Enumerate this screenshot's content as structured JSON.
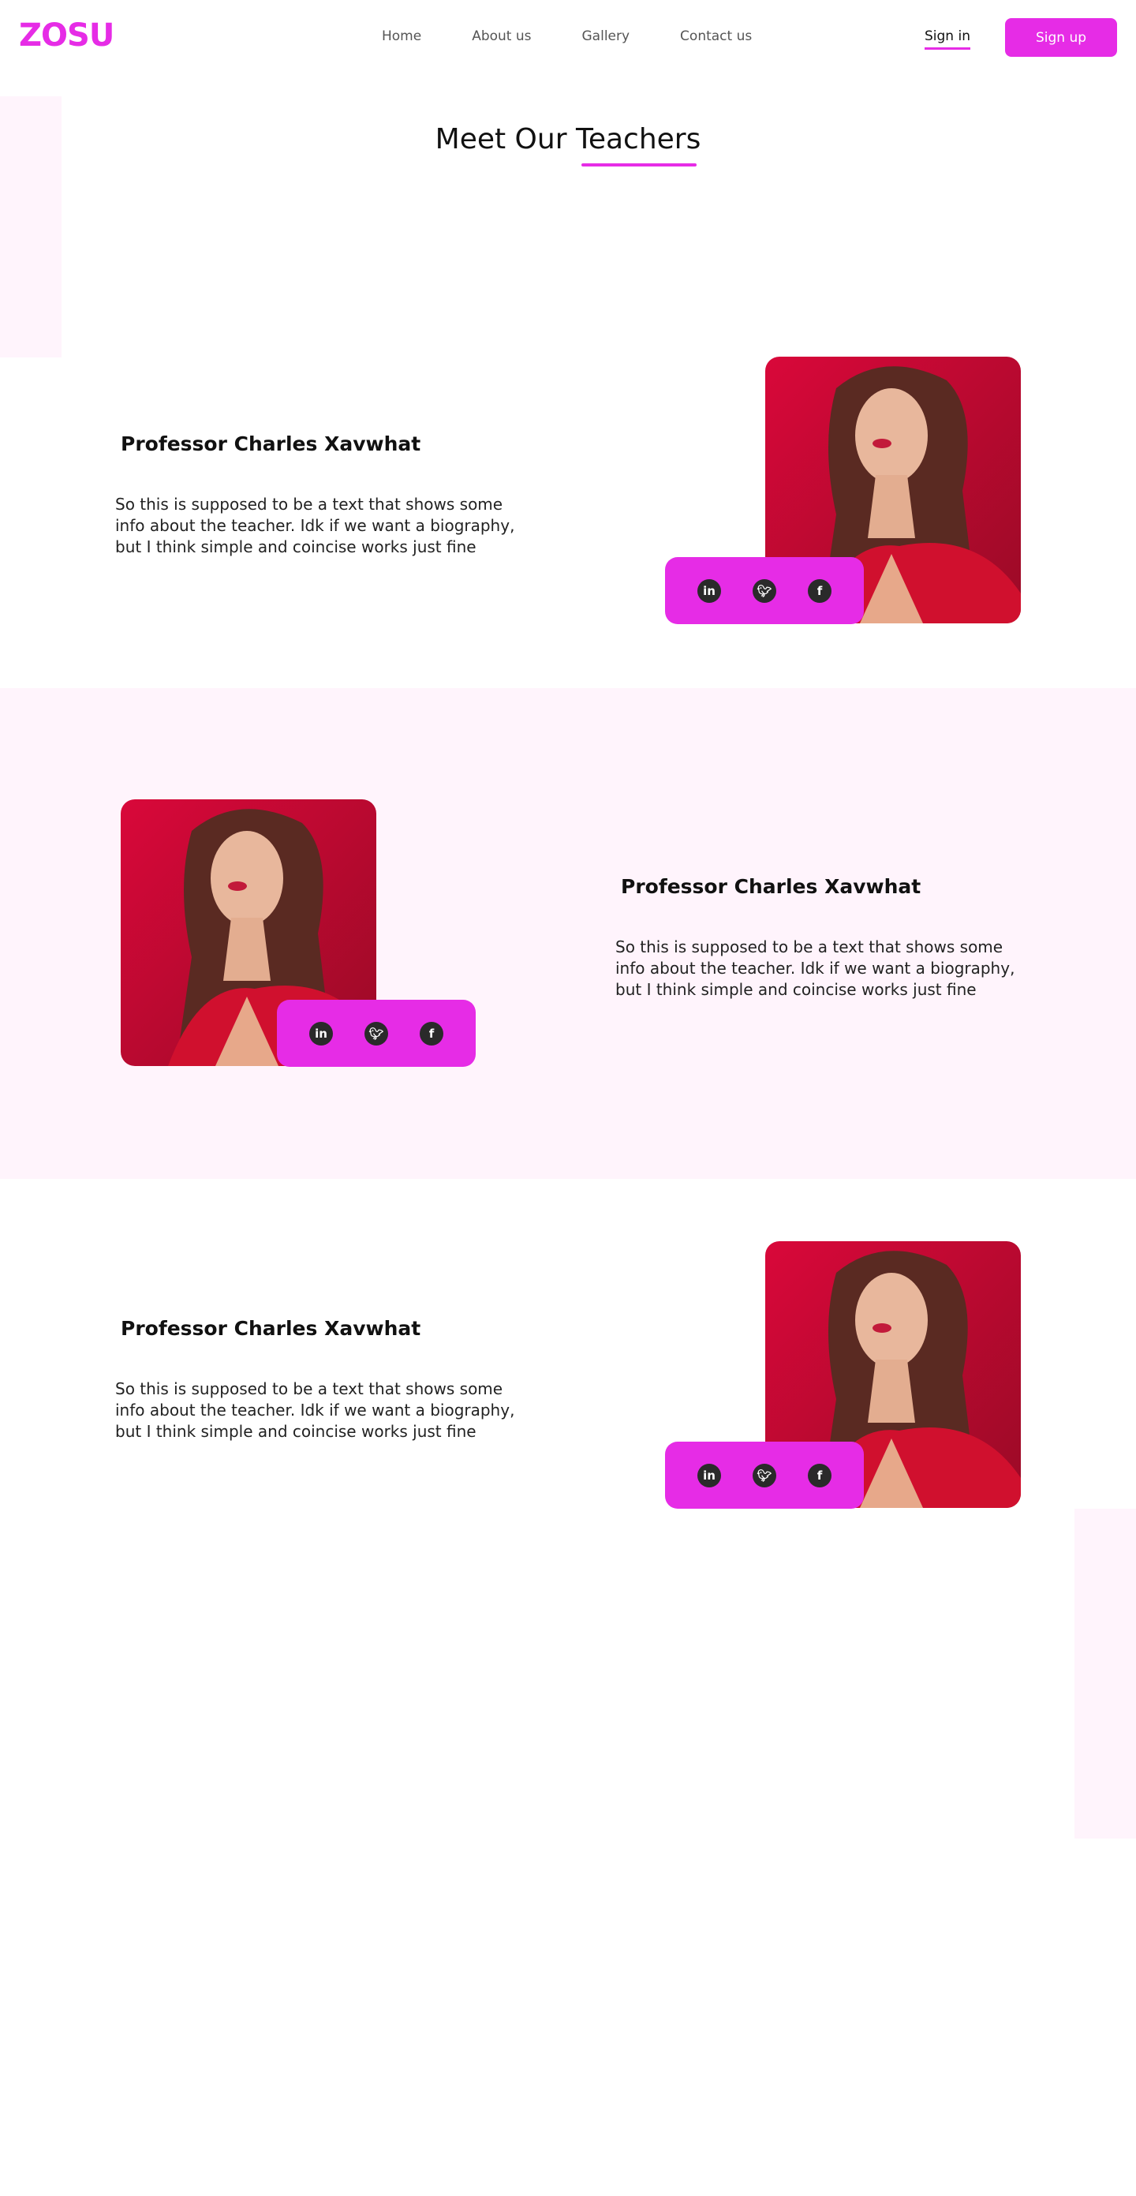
{
  "header": {
    "logo": "ZOSU",
    "nav": [
      "Home",
      "About us",
      "Gallery",
      "Contact us"
    ],
    "signin": "Sign in",
    "signup": "Sign up"
  },
  "page": {
    "title": "Meet Our Teachers"
  },
  "teachers": [
    {
      "name": "Professor Charles Xavwhat",
      "bio": "So this is supposed to be a text that shows some info about the teacher. Idk if we want a biography, but I think simple and coincise works just fine",
      "social": [
        "linkedin-icon",
        "twitter-icon",
        "facebook-icon"
      ]
    },
    {
      "name": "Professor Charles Xavwhat",
      "bio": "So this is supposed to be a text that shows some info about the teacher. Idk if we want a biography, but I think simple and coincise works just fine",
      "social": [
        "linkedin-icon",
        "twitter-icon",
        "facebook-icon"
      ]
    },
    {
      "name": "Professor Charles Xavwhat",
      "bio": "So this is supposed to be a text that shows some info about the teacher. Idk if we want a biography, but I think simple and coincise works just fine",
      "social": [
        "linkedin-icon",
        "twitter-icon",
        "facebook-icon"
      ]
    }
  ],
  "colors": {
    "accent": "#e62ce6",
    "band": "#fff4fc",
    "photo_red": "#c8103a"
  }
}
